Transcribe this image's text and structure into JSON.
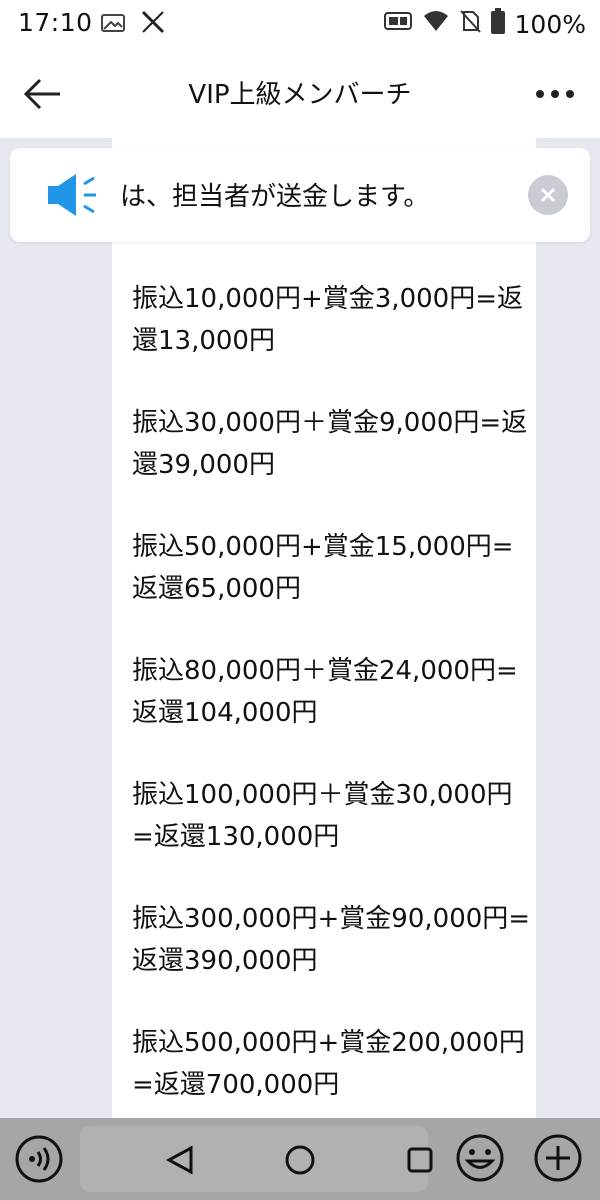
{
  "status_bar": {
    "time": "17:10",
    "battery_percent": "100%",
    "icons_left": [
      "gallery-icon",
      "x-logo-icon"
    ],
    "icons_right": [
      "90hz-icon",
      "wifi-icon",
      "no-sim-icon",
      "battery-icon"
    ]
  },
  "header": {
    "title": "VIP上級メンバーチ",
    "back_icon": "arrow-left-icon",
    "menu_icon": "more-dots-icon"
  },
  "announcement": {
    "text": "は、担当者が送金します。",
    "icon": "megaphone-icon",
    "close_icon": "close-icon"
  },
  "message": {
    "lines": [
      "振込10,000円+賞金3,000円=返還13,000円",
      "振込30,000円＋賞金9,000円=返還39,000円",
      "振込50,000円+賞金15,000円=返還65,000円",
      "振込80,000円＋賞金24,000円=返還104,000円",
      "振込100,000円＋賞金30,000円=返還130,000円",
      "振込300,000円+賞金90,000円=返還390,000円",
      "振込500,000円+賞金200,000円=返還700,000円"
    ]
  },
  "bottom_bar": {
    "icons": [
      "voice-icon",
      "back-triangle-icon",
      "home-circle-icon",
      "recents-square-icon",
      "emoji-icon",
      "add-circle-icon"
    ]
  },
  "colors": {
    "accent_blue": "#2196e8",
    "chat_background": "#e6e9ef",
    "nav_overlay": "#969696"
  }
}
